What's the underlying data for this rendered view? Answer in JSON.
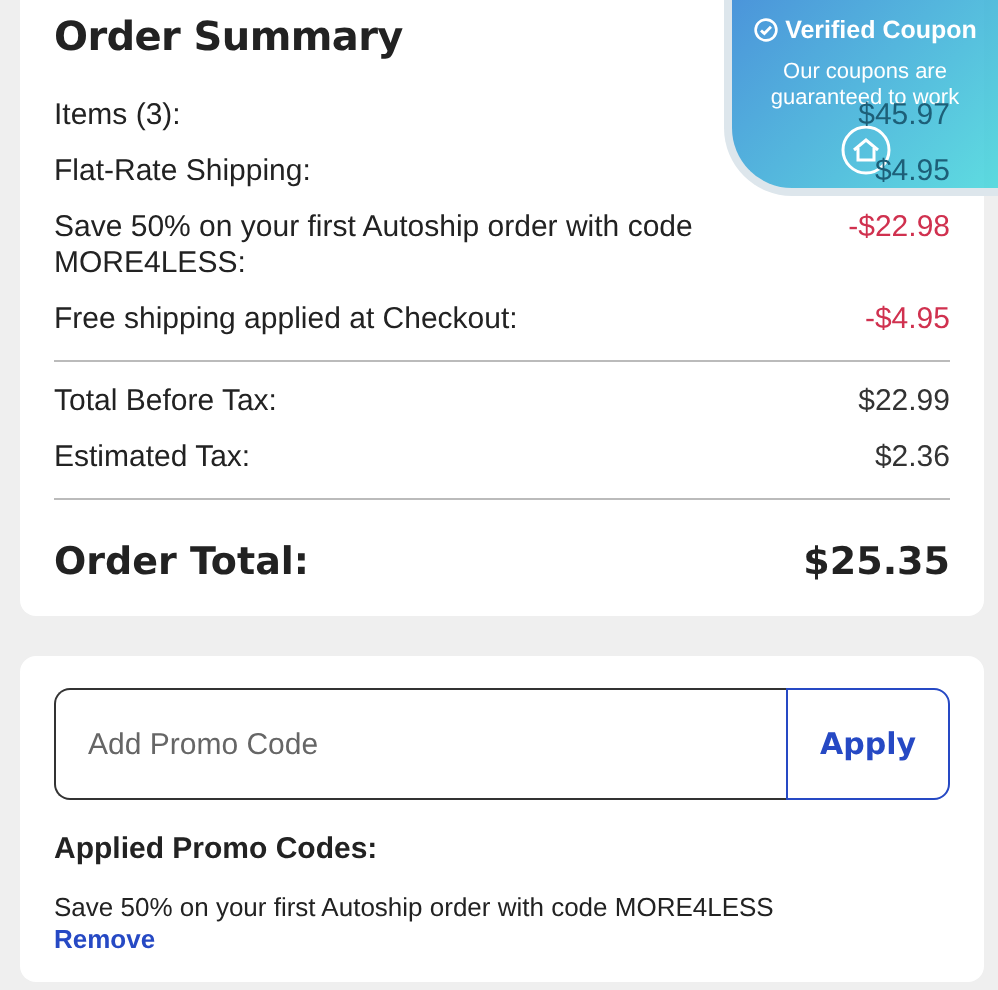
{
  "order_summary": {
    "title": "Order Summary",
    "lines": [
      {
        "label": "Items (3):",
        "value": "$45.97",
        "kind": "normal"
      },
      {
        "label": "Flat-Rate Shipping:",
        "value": "$4.95",
        "kind": "normal"
      },
      {
        "label": "Save 50% on your first Autoship order with code MORE4LESS:",
        "value": "-$22.98",
        "kind": "discount"
      },
      {
        "label": "Free shipping applied at Checkout:",
        "value": "-$4.95",
        "kind": "discount"
      }
    ],
    "subtotals": [
      {
        "label": "Total Before Tax:",
        "value": "$22.99"
      },
      {
        "label": "Estimated Tax:",
        "value": "$2.36"
      }
    ],
    "total": {
      "label": "Order Total:",
      "value": "$25.35"
    }
  },
  "coupon_badge": {
    "title": "Verified Coupon",
    "text": "Our coupons are guaranteed to work"
  },
  "promo": {
    "placeholder": "Add Promo Code",
    "button": "Apply",
    "applied_title": "Applied Promo Codes:",
    "applied": [
      {
        "text": "Save 50% on your first Autoship order with code MORE4LESS",
        "action": "Remove"
      }
    ]
  }
}
